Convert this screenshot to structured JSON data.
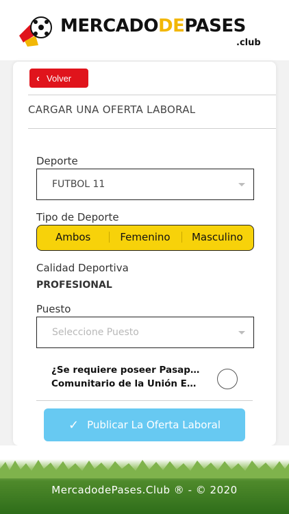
{
  "brand": {
    "name_part1": "MERCADO",
    "name_part2": "DE",
    "name_part3": "PASES",
    "suffix": ".club",
    "colors": {
      "gold": "#f2b705",
      "dark": "#111111",
      "red": "#e0141c"
    }
  },
  "nav": {
    "back_label": "Volver",
    "back_icon": "chevron-left-icon"
  },
  "page": {
    "title": "CARGAR UNA OFERTA LABORAL"
  },
  "form": {
    "sport": {
      "label": "Deporte",
      "value": "FUTBOL 11"
    },
    "sport_type": {
      "label": "Tipo de Deporte",
      "options": [
        "Ambos",
        "Femenino",
        "Masculino"
      ]
    },
    "quality": {
      "label": "Calidad Deportiva",
      "value": "PROFESIONAL"
    },
    "position": {
      "label": "Puesto",
      "placeholder": "Seleccione Puesto"
    },
    "passport_question": {
      "line1": "¿Se requiere poseer Pasap…",
      "line2": "Comunitario de la Unión E…"
    },
    "publish_label": "Publicar La Oferta Laboral"
  },
  "footer": {
    "text": "MercadodePases.Club ® - © 2020"
  },
  "colors": {
    "accent_yellow": "#f7d20a",
    "publish_blue": "#67c9f2"
  }
}
